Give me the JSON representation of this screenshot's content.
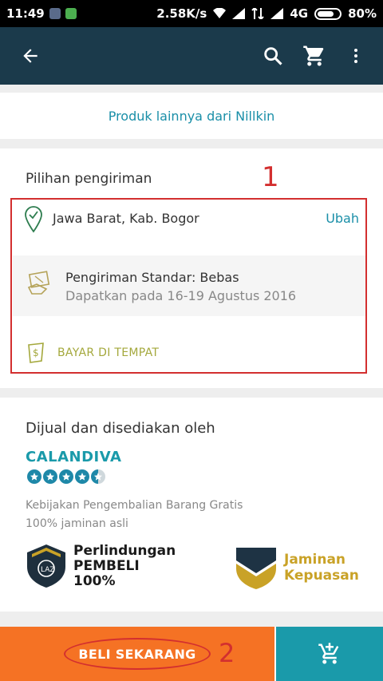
{
  "status_bar": {
    "time": "11:49",
    "speed": "2.58K/s",
    "network": "4G",
    "battery": "80%"
  },
  "toolbar": {
    "icons": [
      "back-arrow-icon",
      "search-icon",
      "cart-icon",
      "more-vert-icon"
    ]
  },
  "more_products": {
    "label": "Produk lainnya dari Nillkin"
  },
  "shipping": {
    "title": "Pilihan pengiriman",
    "location": "Jawa Barat, Kab. Bogor",
    "change_label": "Ubah",
    "standard_title": "Pengiriman Standar: Bebas",
    "standard_date": "Dapatkan pada 16-19 Agustus 2016",
    "cod_label": "BAYAR DI TEMPAT"
  },
  "seller": {
    "title": "Dijual dan disediakan oleh",
    "name": "CALANDIVA",
    "rating": 4.5,
    "rating_max": 5,
    "policy_return": "Kebijakan Pengembalian Barang Gratis",
    "policy_authentic": "100% jaminan asli",
    "badge_protection": [
      "Perlindungan",
      "PEMBELI",
      "100%"
    ],
    "badge_satisfaction": [
      "Jaminan",
      "Kepuasan"
    ]
  },
  "actions": {
    "buy_label": "BELI SEKARANG"
  },
  "annotations": {
    "marker_1": "1",
    "marker_2": "2"
  },
  "colors": {
    "topbar": "#1b3a4b",
    "link": "#1a8fa8",
    "buy": "#f57224",
    "add_to_cart": "#1a9aaa",
    "annotation": "#d32f2f"
  }
}
